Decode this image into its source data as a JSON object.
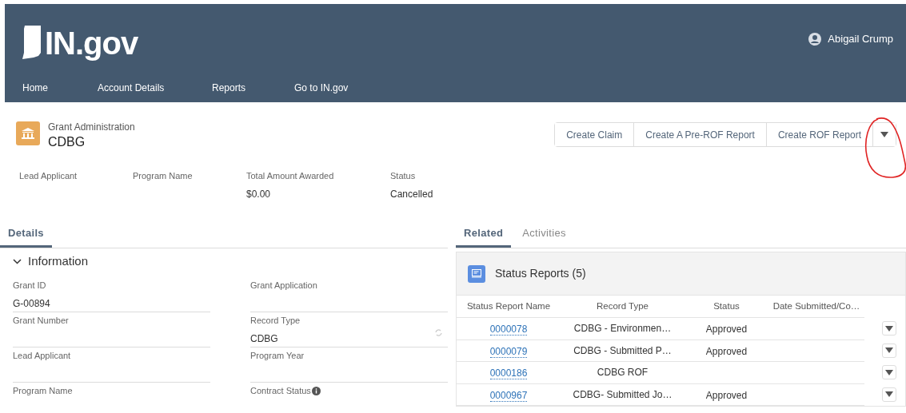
{
  "header": {
    "logo": "IN.gov",
    "user": "Abigail Crump",
    "nav": [
      {
        "label": "Home"
      },
      {
        "label": "Account Details"
      },
      {
        "label": "Reports"
      },
      {
        "label": "Go to IN.gov"
      }
    ]
  },
  "record": {
    "object": "Grant Administration",
    "name": "CDBG",
    "actions": [
      "Create Claim",
      "Create A Pre-ROF Report",
      "Create ROF Report"
    ],
    "highlights": [
      {
        "label": "Lead Applicant"
      },
      {
        "label": "Program Name"
      },
      {
        "label": "Total Amount Awarded",
        "value": "$0.00"
      },
      {
        "label": "Status",
        "value": "Cancelled"
      }
    ]
  },
  "annotation": {
    "kind": "circle",
    "color": "#e02424"
  },
  "left_tabs": [
    {
      "label": "Details",
      "selected": true
    }
  ],
  "section": {
    "title": "Information",
    "expanded": true,
    "fields": [
      {
        "label": "Grant ID",
        "value": "G-00894"
      },
      {
        "label": "Grant Application"
      },
      {
        "label": "Grant Number"
      },
      {
        "label": "Record Type",
        "value": "CDBG",
        "kind": "changeable"
      },
      {
        "label": "Lead Applicant"
      },
      {
        "label": "Program Year"
      },
      {
        "label": "Program Name"
      },
      {
        "label": "Contract Status",
        "kind": "info"
      }
    ]
  },
  "right_tabs": [
    {
      "label": "Related",
      "selected": true
    },
    {
      "label": "Activities",
      "selected": false
    }
  ],
  "related": {
    "title": "Status Reports (5)",
    "columns": [
      "Status Report Name",
      "Record Type",
      "Status",
      "Date Submitted/Co…"
    ],
    "rows": [
      {
        "name": "0000078",
        "record_type": "CDBG - Environmen…",
        "status": "Approved"
      },
      {
        "name": "0000079",
        "record_type": "CDBG - Submitted P…",
        "status": "Approved"
      },
      {
        "name": "0000186",
        "record_type": "CDBG ROF"
      },
      {
        "name": "0000967",
        "record_type": "CDBG- Submitted Jo…",
        "status": "Approved"
      }
    ]
  }
}
